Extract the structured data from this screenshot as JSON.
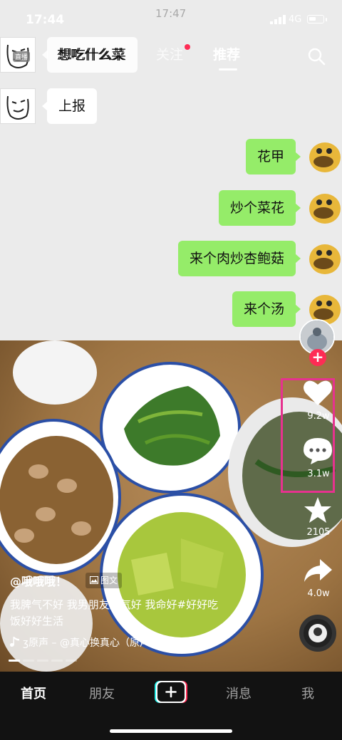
{
  "status": {
    "time": "17:44",
    "time_center": "17:47",
    "network": "4G"
  },
  "top_tabs": {
    "tab1": "想吃什么菜",
    "tab2": "关注",
    "tab3": "推荐"
  },
  "live_badge": "直播",
  "chat": {
    "left_messages": [
      "想吃什么菜",
      "上报"
    ],
    "right_messages": [
      "花甲",
      "炒个菜花",
      "来个肉炒杏鲍菇",
      "来个汤"
    ]
  },
  "actions": {
    "likes": "9.2w",
    "comments": "3.1w",
    "favorites": "2105",
    "shares": "4.0w"
  },
  "caption": {
    "username": "@哦哦哦！",
    "post_type": "图文",
    "text_line1": "我脾气不好 我男朋友脾气好 我命好#好好吃",
    "text_line2": "饭好好生活",
    "music": "ʒ原声 – @真心换真心（原声"
  },
  "bottom_nav": {
    "home": "首页",
    "friends": "朋友",
    "messages": "消息",
    "me": "我"
  },
  "colors": {
    "accent_red": "#fe2c55",
    "bubble_green": "#95ec69",
    "highlight": "#e6328f",
    "plate_rim": "#2b4fa6"
  }
}
